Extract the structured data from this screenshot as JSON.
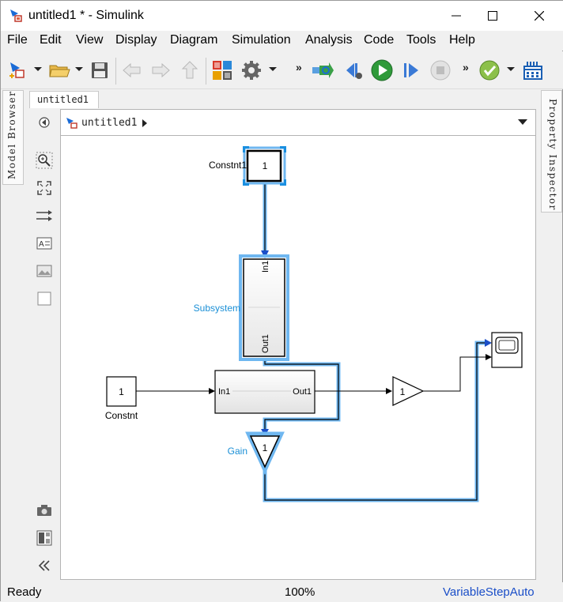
{
  "window": {
    "title": "untitled1 * - Simulink",
    "controls": {
      "minimize_icon": "minimize-icon",
      "maximize_icon": "maximize-icon",
      "close_icon": "close-icon"
    }
  },
  "menu": {
    "items": [
      {
        "label": "File"
      },
      {
        "label": "Edit"
      },
      {
        "label": "View"
      },
      {
        "label": "Display"
      },
      {
        "label": "Diagram"
      },
      {
        "label": "Simulation"
      },
      {
        "label": "Analysis"
      },
      {
        "label": "Code"
      },
      {
        "label": "Tools"
      },
      {
        "label": "Help"
      }
    ]
  },
  "toolbar": {
    "more_label": "»",
    "icons": [
      "new-model-icon",
      "open-folder-icon",
      "save-icon",
      "back-icon",
      "forward-icon",
      "up-icon",
      "library-browser-icon",
      "model-settings-icon",
      "step-back-icon",
      "run-icon",
      "step-forward-icon",
      "stop-icon",
      "check-icon",
      "data-inspector-icon"
    ]
  },
  "side_panels": {
    "left_label": "Model Browser",
    "right_label": "Property Inspector"
  },
  "tabs": {
    "active": "untitled1"
  },
  "breadcrumb": {
    "label": "untitled1"
  },
  "diagram": {
    "blocks": {
      "constnt1": {
        "name": "Constnt1",
        "value": "1"
      },
      "subsystem": {
        "name": "Subsystem",
        "in_port": "In1",
        "out_port": "Out1"
      },
      "constnt": {
        "name": "Constnt",
        "value": "1"
      },
      "subsystem_plain": {
        "in_port": "In1",
        "out_port": "Out1"
      },
      "gain_right": {
        "value": "1"
      },
      "gain": {
        "name": "Gain",
        "value": "1"
      }
    },
    "colors": {
      "selected": "#1a8fe0",
      "highlight": "#6fb7f0",
      "label_blue": "#1a8fd6"
    }
  },
  "status": {
    "ready": "Ready",
    "zoom": "100%",
    "solver": "VariableStepAuto"
  }
}
